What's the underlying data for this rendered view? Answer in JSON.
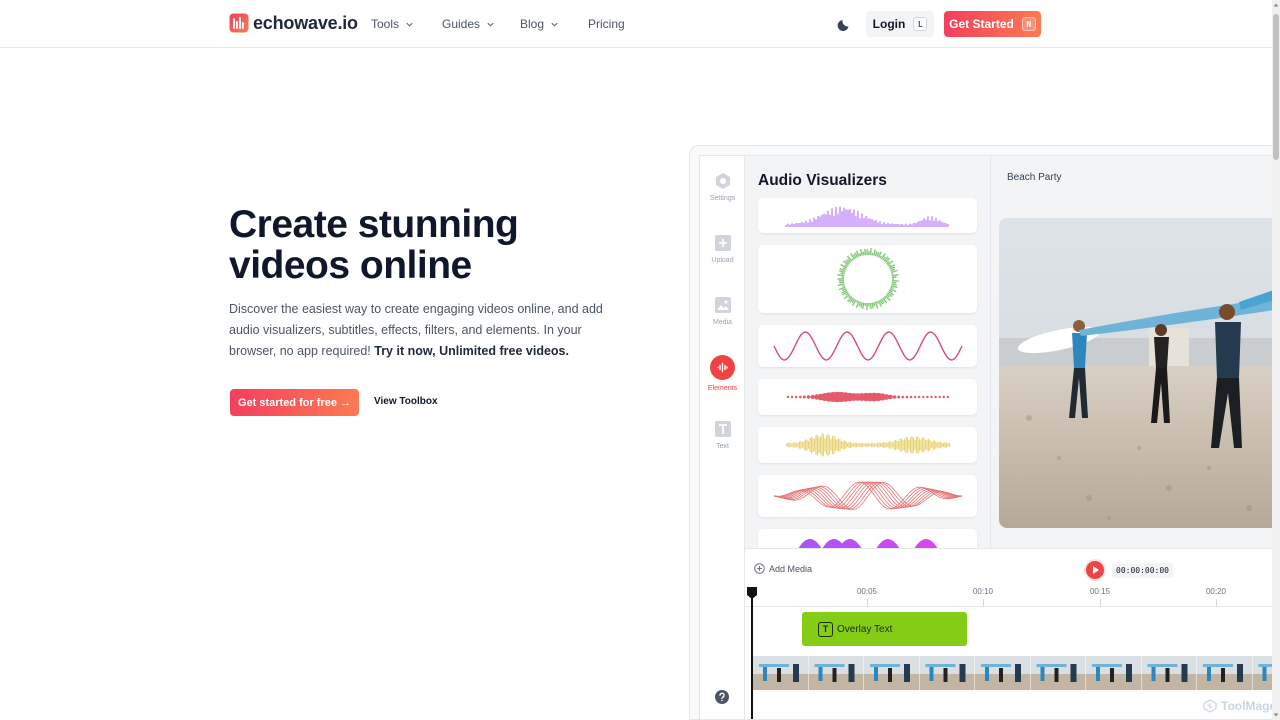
{
  "brand": {
    "name": "echowave.io",
    "accent": "#f43f5e",
    "accent_end": "#fb7b52"
  },
  "nav": {
    "items": [
      {
        "label": "Tools",
        "has_dropdown": true
      },
      {
        "label": "Guides",
        "has_dropdown": true
      },
      {
        "label": "Blog",
        "has_dropdown": true
      },
      {
        "label": "Pricing",
        "has_dropdown": false
      }
    ],
    "theme_icon": "moon-icon",
    "login": {
      "label": "Login",
      "shortcut": "L"
    },
    "get_started": {
      "label": "Get Started",
      "shortcut": "N"
    }
  },
  "hero": {
    "title_line1": "Create stunning",
    "title_line2": "videos online",
    "description": "Discover the easiest way to create engaging videos online, and add audio visualizers, subtitles, effects, filters, and elements. In your browser, no app required!",
    "description_bold": "Try it now, Unlimited free videos.",
    "primary_cta": "Get started for free →",
    "secondary_cta": "View Toolbox"
  },
  "editor": {
    "tools": [
      {
        "label": "Settings",
        "icon": "hexagon-icon",
        "active": false
      },
      {
        "label": "Upload",
        "icon": "plus-square-icon",
        "active": false
      },
      {
        "label": "Media",
        "icon": "image-icon",
        "active": false
      },
      {
        "label": "Elements",
        "icon": "waveform-icon",
        "active": true
      },
      {
        "label": "Text",
        "icon": "text-icon",
        "active": false
      }
    ],
    "panel_title": "Audio Visualizers",
    "visualizers": [
      "purple-bars",
      "green-circle",
      "pink-sine",
      "red-dots",
      "yellow-wave",
      "red-multi-sine",
      "purple-hills"
    ],
    "project_name": "Beach Party",
    "timeline": {
      "add_media": "Add Media",
      "timecode": "00:00:00:00",
      "ticks": [
        "00:05",
        "00:10",
        "00:15",
        "00:20"
      ],
      "overlay_clip_icon": "T",
      "overlay_clip_label": "Overlay Text"
    }
  },
  "watermark": "ToolMage"
}
